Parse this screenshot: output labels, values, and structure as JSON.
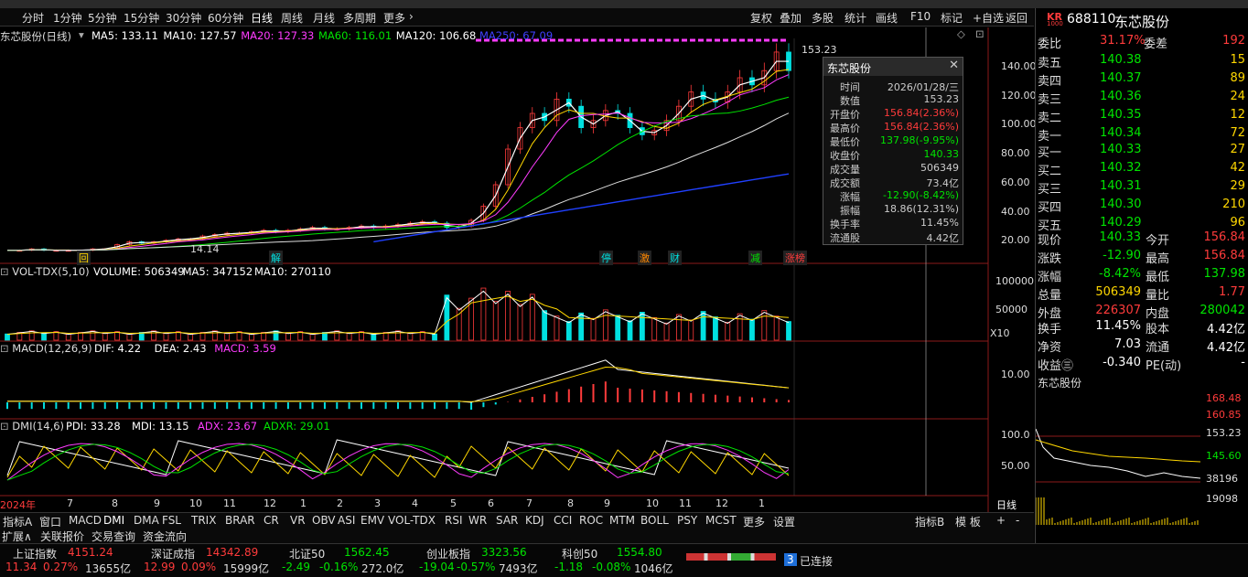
{
  "toolbar": {
    "periods": [
      "分时",
      "1分钟",
      "5分钟",
      "15分钟",
      "30分钟",
      "60分钟",
      "日线",
      "周线",
      "月线",
      "多周期",
      "更多"
    ],
    "right": [
      "复权",
      "叠加",
      "多股",
      "统计",
      "画线",
      "F10",
      "标记",
      "+自选",
      "返回"
    ]
  },
  "main": {
    "title": "东芯股份(日线)",
    "ma": [
      {
        "label": "MA5: 133.11",
        "color": "#ffffff"
      },
      {
        "label": "MA10: 127.57",
        "color": "#ffffff"
      },
      {
        "label": "MA20: 127.33",
        "color": "#ff3cff"
      },
      {
        "label": "MA60: 116.01",
        "color": "#00e400"
      },
      {
        "label": "MA120: 106.68",
        "color": "#ffffff"
      },
      {
        "label": "MA250: 67.09",
        "color": "#4040ff"
      }
    ],
    "y_ticks": [
      "140.00",
      "120.00",
      "100.00",
      "80.00",
      "60.00",
      "40.00",
      "20.00"
    ],
    "high_label": "153.23",
    "low_label": "14.14",
    "events": [
      {
        "text": "回",
        "color": "#ffd700"
      },
      {
        "text": "解",
        "color": "#00e0e0"
      },
      {
        "text": "停",
        "color": "#00e0e0"
      },
      {
        "text": "激",
        "color": "#ff8800"
      },
      {
        "text": "财",
        "color": "#00e0e0"
      },
      {
        "text": "减",
        "color": "#00e400"
      },
      {
        "text": "涨榜",
        "color": "#ff3b3b"
      }
    ]
  },
  "vol": {
    "title": "VOL-TDX(5,10)",
    "items": [
      "VOLUME: 506349",
      "MA5: 347152",
      "MA10: 270110"
    ],
    "y_ticks": [
      "100000",
      "50000"
    ],
    "unit": "X10"
  },
  "macd": {
    "title": "MACD(12,26,9)",
    "items": [
      "DIF: 4.22",
      "DEA: 2.43",
      "MACD: 3.59"
    ],
    "y_ticks": [
      "10.00"
    ]
  },
  "dmi": {
    "title": "DMI(14,6)",
    "items": [
      "PDI: 33.28",
      "MDI: 13.15",
      "ADX: 23.67",
      "ADXR: 29.01"
    ],
    "y_ticks": [
      "100.0",
      "50.00"
    ]
  },
  "x_axis": [
    "2024年",
    "7",
    "8",
    "9",
    "10",
    "11",
    "12",
    "1",
    "2",
    "3",
    "4",
    "5",
    "6",
    "7",
    "8",
    "9",
    "10",
    "11",
    "12",
    "1"
  ],
  "period_label": "日线",
  "tooltip": {
    "title": "东芯股份",
    "rows": [
      {
        "k": "时间",
        "v": "2026/01/28/三",
        "c": "#ccc"
      },
      {
        "k": "数值",
        "v": "153.23",
        "c": "#ccc"
      },
      {
        "k": "开盘价",
        "v": "156.84(2.36%)",
        "c": "#ff3b3b"
      },
      {
        "k": "最高价",
        "v": "156.84(2.36%)",
        "c": "#ff3b3b"
      },
      {
        "k": "最低价",
        "v": "137.98(-9.95%)",
        "c": "#00e400"
      },
      {
        "k": "收盘价",
        "v": "140.33",
        "c": "#00e400"
      },
      {
        "k": "成交量",
        "v": "506349",
        "c": "#ccc"
      },
      {
        "k": "成交额",
        "v": "73.4亿",
        "c": "#ccc"
      },
      {
        "k": "涨幅",
        "v": "-12.90(-8.42%)",
        "c": "#00e400"
      },
      {
        "k": "振幅",
        "v": "18.86(12.31%)",
        "c": "#ccc"
      },
      {
        "k": "换手率",
        "v": "11.45%",
        "c": "#ccc"
      },
      {
        "k": "流通股",
        "v": "4.42亿",
        "c": "#ccc"
      }
    ]
  },
  "tabs": [
    "指标A",
    "窗口",
    "MACD",
    "DMI",
    "DMA",
    "FSL",
    "TRIX",
    "BRAR",
    "CR",
    "VR",
    "OBV",
    "ASI",
    "EMV",
    "VOL-TDX",
    "RSI",
    "WR",
    "SAR",
    "KDJ",
    "CCI",
    "ROC",
    "MTM",
    "BOLL",
    "PSY",
    "MCST",
    "更多",
    "设置"
  ],
  "tabs_right": [
    "指标B",
    "模 板",
    "+",
    "-"
  ],
  "tabs2": [
    "扩展∧",
    "关联报价",
    "交易查询",
    "资金流向"
  ],
  "quote": {
    "badge": "KR",
    "badge_sub": "1000",
    "code": "688110",
    "name": "东芯股份",
    "weibi": {
      "l1": "委比",
      "v1": "31.17%",
      "l2": "委差",
      "v2": "192"
    },
    "asks": [
      {
        "l": "卖五",
        "p": "140.38",
        "q": "15"
      },
      {
        "l": "卖四",
        "p": "140.37",
        "q": "89"
      },
      {
        "l": "卖三",
        "p": "140.36",
        "q": "24"
      },
      {
        "l": "卖二",
        "p": "140.35",
        "q": "12"
      },
      {
        "l": "卖一",
        "p": "140.34",
        "q": "72"
      }
    ],
    "bids": [
      {
        "l": "买一",
        "p": "140.33",
        "q": "27"
      },
      {
        "l": "买二",
        "p": "140.32",
        "q": "42"
      },
      {
        "l": "买三",
        "p": "140.31",
        "q": "29"
      },
      {
        "l": "买四",
        "p": "140.30",
        "q": "210"
      },
      {
        "l": "买五",
        "p": "140.29",
        "q": "96"
      }
    ],
    "stats": [
      {
        "l1": "现价",
        "v1": "140.33",
        "c1": "#00e400",
        "l2": "今开",
        "v2": "156.84",
        "c2": "#ff3b3b"
      },
      {
        "l1": "涨跌",
        "v1": "-12.90",
        "c1": "#00e400",
        "l2": "最高",
        "v2": "156.84",
        "c2": "#ff3b3b"
      },
      {
        "l1": "涨幅",
        "v1": "-8.42%",
        "c1": "#00e400",
        "l2": "最低",
        "v2": "137.98",
        "c2": "#00e400"
      },
      {
        "l1": "总量",
        "v1": "506349",
        "c1": "#ffd700",
        "l2": "量比",
        "v2": "1.77",
        "c2": "#ff3b3b"
      },
      {
        "l1": "外盘",
        "v1": "226307",
        "c1": "#ff3b3b",
        "l2": "内盘",
        "v2": "280042",
        "c2": "#00e400"
      }
    ],
    "stats2": [
      {
        "l1": "换手",
        "v1": "11.45%",
        "l2": "股本",
        "v2": "4.42亿"
      },
      {
        "l1": "净资",
        "v1": "7.03",
        "l2": "流通",
        "v2": "4.42亿"
      },
      {
        "l1": "收益㊂",
        "v1": "-0.340",
        "l2": "PE(动)",
        "v2": "-"
      }
    ],
    "mini_title": "东芯股份",
    "mini_ticks": [
      "168.48",
      "160.85",
      "153.23",
      "145.60",
      "38196",
      "19098"
    ]
  },
  "ticker": [
    {
      "name": "上证指数",
      "val": "4151.24",
      "chg": "11.34",
      "pct": "0.27%",
      "amt": "13655亿",
      "color": "#ff3b3b"
    },
    {
      "name": "深证成指",
      "val": "14342.89",
      "chg": "12.99",
      "pct": "0.09%",
      "amt": "15999亿",
      "color": "#ff3b3b"
    },
    {
      "name": "北证50",
      "val": "1562.45",
      "chg": "-2.49",
      "pct": "-0.16%",
      "amt": "272.0亿",
      "color": "#00e400"
    },
    {
      "name": "创业板指",
      "val": "3323.56",
      "chg": "-19.04",
      "pct": "-0.57%",
      "amt": "7493亿",
      "color": "#00e400"
    },
    {
      "name": "科创50",
      "val": "1554.80",
      "chg": "-1.18",
      "pct": "-0.08%",
      "amt": "1046亿",
      "color": "#00e400"
    }
  ],
  "status": {
    "count": "3",
    "text": "已连接"
  },
  "chart_data": {
    "type": "candlestick",
    "title": "东芯股份(日线)",
    "close_path": [
      14,
      14,
      15,
      14,
      14,
      14,
      14,
      15,
      15,
      18,
      20,
      19,
      20,
      21,
      22,
      22,
      24,
      25,
      26,
      26,
      27,
      28,
      27,
      28,
      29,
      30,
      29,
      29,
      30,
      31,
      30,
      31,
      32,
      33,
      34,
      33,
      30,
      31,
      35,
      45,
      60,
      85,
      100,
      110,
      105,
      120,
      115,
      100,
      105,
      112,
      110,
      100,
      95,
      98,
      105,
      115,
      125,
      120,
      118,
      125,
      135,
      130,
      140,
      153,
      140
    ],
    "ylim": [
      10,
      160
    ]
  }
}
